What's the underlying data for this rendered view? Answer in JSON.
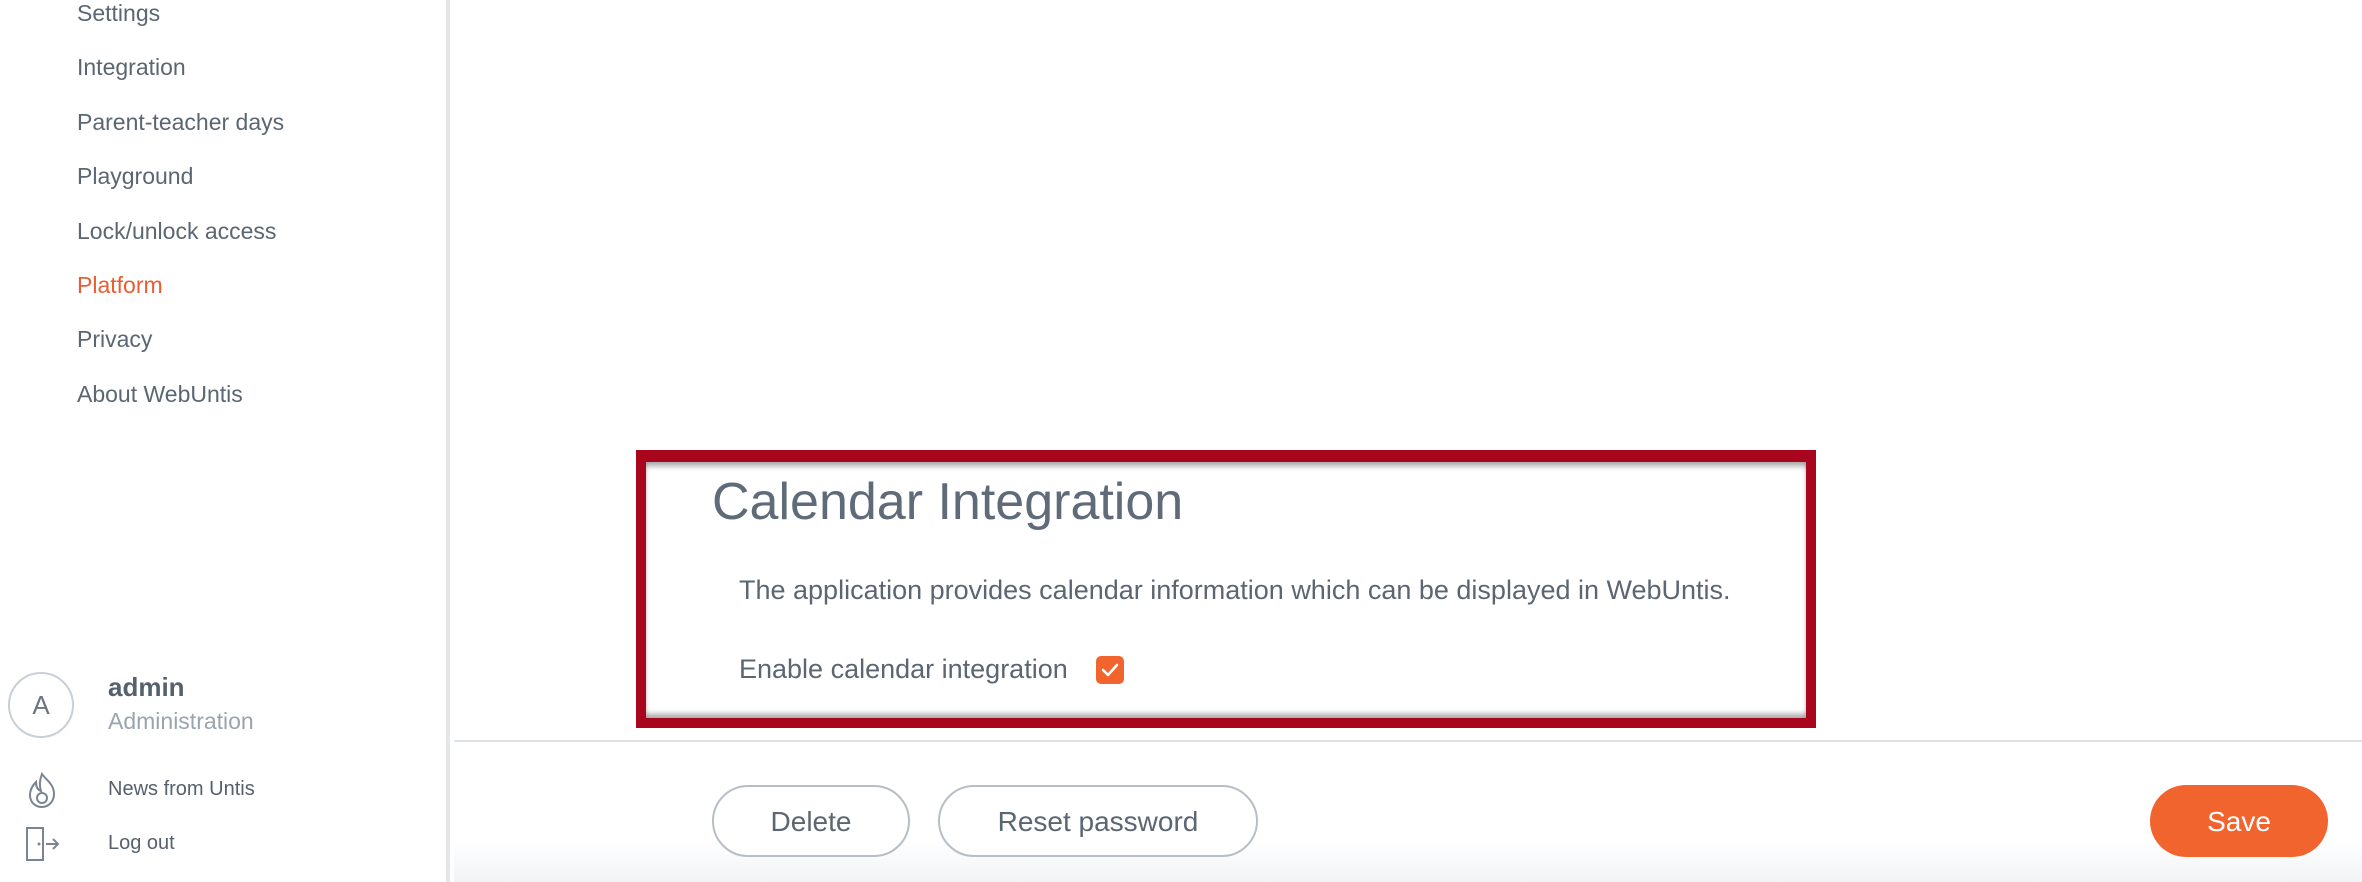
{
  "sidebar": {
    "items": [
      {
        "label": "Settings"
      },
      {
        "label": "Integration"
      },
      {
        "label": "Parent-teacher days"
      },
      {
        "label": "Playground"
      },
      {
        "label": "Lock/unlock access"
      },
      {
        "label": "Platform",
        "active": true
      },
      {
        "label": "Privacy"
      },
      {
        "label": "About WebUntis"
      }
    ],
    "user": {
      "avatar_letter": "A",
      "name": "admin",
      "role": "Administration"
    },
    "news_label": "News from Untis",
    "logout_label": "Log out"
  },
  "section": {
    "title": "Calendar Integration",
    "description": "The application provides calendar information which can be displayed in WebUntis.",
    "checkbox_label": "Enable calendar integration",
    "checkbox_checked": true
  },
  "footer": {
    "delete_label": "Delete",
    "reset_label": "Reset password",
    "save_label": "Save"
  },
  "colors": {
    "accent": "#f2642e",
    "active_nav": "#e95d32",
    "highlight_border": "#a7061c"
  },
  "icons": {
    "news": "flame-icon",
    "logout": "logout-door-icon",
    "checkbox": "checkmark-icon"
  }
}
